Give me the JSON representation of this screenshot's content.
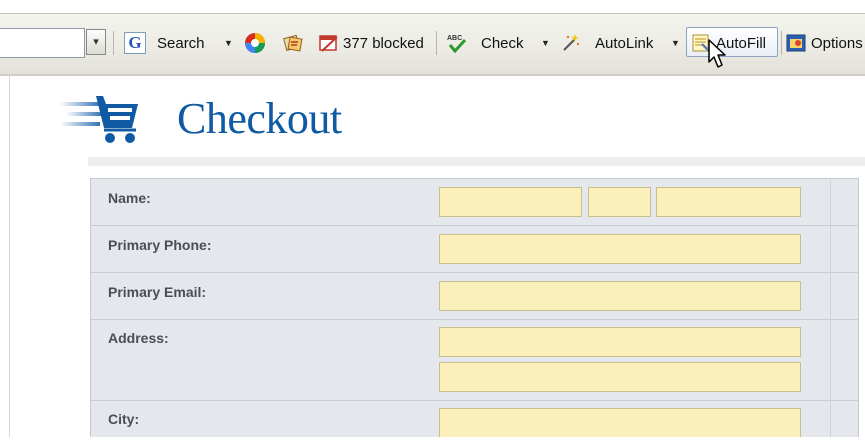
{
  "toolbar": {
    "search_label": "Search",
    "blocked_label": "377 blocked",
    "check_label": "Check",
    "autolink_label": "AutoLink",
    "autofill_label": "AutoFill",
    "options_label": "Options",
    "dropdown_glyph": "▾",
    "arrow_glyph": "▼",
    "g_glyph": "G"
  },
  "page": {
    "title": "Checkout",
    "accent_color": "#0f5aa3",
    "field_color": "#fbf0bb"
  },
  "form": {
    "name_label": "Name:",
    "phone_label": "Primary Phone:",
    "email_label": "Primary Email:",
    "address_label": "Address:",
    "city_label": "City:"
  }
}
